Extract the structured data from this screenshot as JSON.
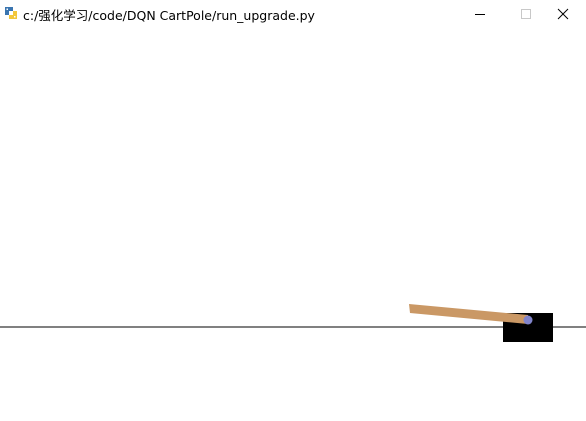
{
  "window": {
    "title": "c:/强化学习/code/DQN CartPole/run_upgrade.py",
    "app_icon": "python-icon",
    "controls": {
      "minimize_icon": "minimize-icon",
      "maximize_icon": "maximize-icon",
      "close_icon": "close-icon"
    }
  },
  "scene": {
    "background_color": "#ffffff",
    "track_color": "#000000",
    "cart_color": "#000000",
    "pole_color": "#ca9865",
    "axle_color": "#8184cb"
  }
}
